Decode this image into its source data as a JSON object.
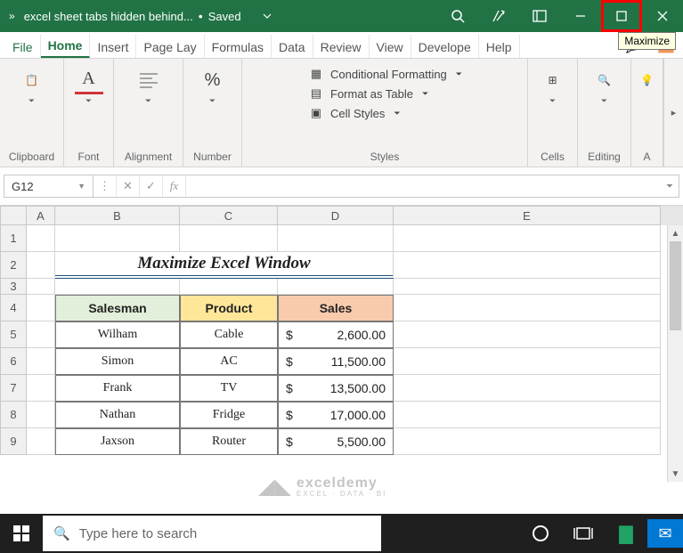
{
  "titlebar": {
    "filename": "excel sheet tabs hidden behind...",
    "status": "Saved",
    "tooltip": "Maximize"
  },
  "menu": {
    "tabs": [
      "File",
      "Home",
      "Insert",
      "Page Lay",
      "Formulas",
      "Data",
      "Review",
      "View",
      "Develope",
      "Help"
    ],
    "active": "Home"
  },
  "ribbon": {
    "groups": [
      "Clipboard",
      "Font",
      "Alignment",
      "Number",
      "Styles",
      "Cells",
      "Editing",
      "A"
    ],
    "styles_items": [
      "Conditional Formatting",
      "Format as Table",
      "Cell Styles"
    ]
  },
  "formula_bar": {
    "namebox": "G12",
    "formula": ""
  },
  "columns": [
    "A",
    "B",
    "C",
    "D",
    "E"
  ],
  "col_widths": {
    "A": 32,
    "B": 140,
    "C": 110,
    "D": 130,
    "E": 300
  },
  "sheet_title": "Maximize Excel Window",
  "table": {
    "headers": [
      "Salesman",
      "Product",
      "Sales"
    ],
    "rows": [
      {
        "salesman": "Wilham",
        "product": "Cable",
        "sales": "2,600.00"
      },
      {
        "salesman": "Simon",
        "product": "AC",
        "sales": "11,500.00"
      },
      {
        "salesman": "Frank",
        "product": "TV",
        "sales": "13,500.00"
      },
      {
        "salesman": "Nathan",
        "product": "Fridge",
        "sales": "17,000.00"
      },
      {
        "salesman": "Jaxson",
        "product": "Router",
        "sales": "5,500.00"
      }
    ],
    "currency": "$"
  },
  "watermark": {
    "brand": "exceldemy",
    "tagline": "EXCEL · DATA · BI"
  },
  "taskbar": {
    "search_placeholder": "Type here to search"
  }
}
